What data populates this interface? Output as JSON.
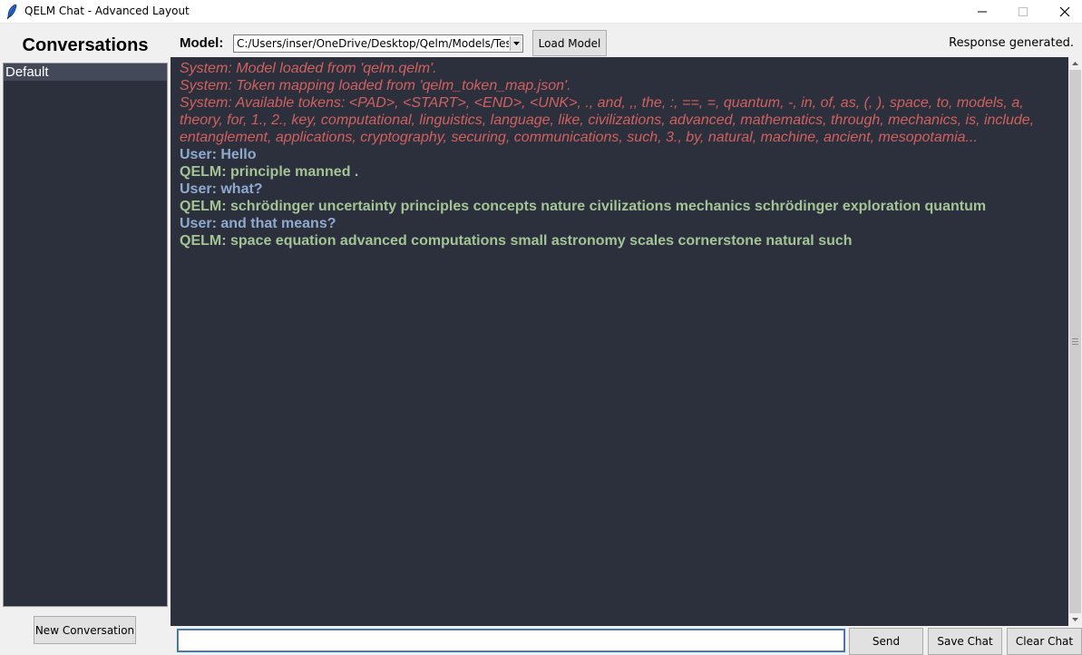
{
  "window": {
    "title": "QELM Chat - Advanced Layout",
    "icon": "feather-icon"
  },
  "sidebar": {
    "heading": "Conversations",
    "items": [
      {
        "label": "Default",
        "selected": true
      }
    ],
    "new_button": "New Conversation"
  },
  "toolbar": {
    "model_label": "Model:",
    "model_path": "C:/Users/inser/OneDrive/Desktop/Qelm/Models/Test/qelm.qelm",
    "load_button": "Load Model",
    "status": "Response generated."
  },
  "chat": {
    "messages": [
      {
        "role": "system",
        "text": "System: Model loaded from 'qelm.qelm'."
      },
      {
        "role": "system",
        "text": "System: Token mapping loaded from 'qelm_token_map.json'."
      },
      {
        "role": "system",
        "text": "System: Available tokens: <PAD>, <START>, <END>, <UNK>, ., and, ,, the, :, ==, =, quantum, -, in, of, as, (, ), space, to, models, a, theory, for, 1., 2., key, computational, linguistics, language, like, civilizations, advanced, mathematics, through, mechanics, is, include, entanglement, applications, cryptography, securing, communications, such, 3., by, natural, machine, ancient, mesopotamia..."
      },
      {
        "role": "user",
        "text": "User: Hello"
      },
      {
        "role": "bot",
        "text": "QELM: principle manned ."
      },
      {
        "role": "user",
        "text": "User: what?"
      },
      {
        "role": "bot",
        "text": "QELM: schrödinger uncertainty principles concepts nature civilizations mechanics schrödinger exploration quantum"
      },
      {
        "role": "user",
        "text": "User: and that means?"
      },
      {
        "role": "bot",
        "text": "QELM: space equation advanced computations small astronomy scales cornerstone natural such"
      }
    ]
  },
  "input": {
    "value": "",
    "send_button": "Send",
    "save_button": "Save Chat",
    "clear_button": "Clear Chat"
  },
  "colors": {
    "chat_bg": "#2c303c",
    "system": "#d0605f",
    "user": "#8eaacf",
    "bot": "#a3c495"
  }
}
